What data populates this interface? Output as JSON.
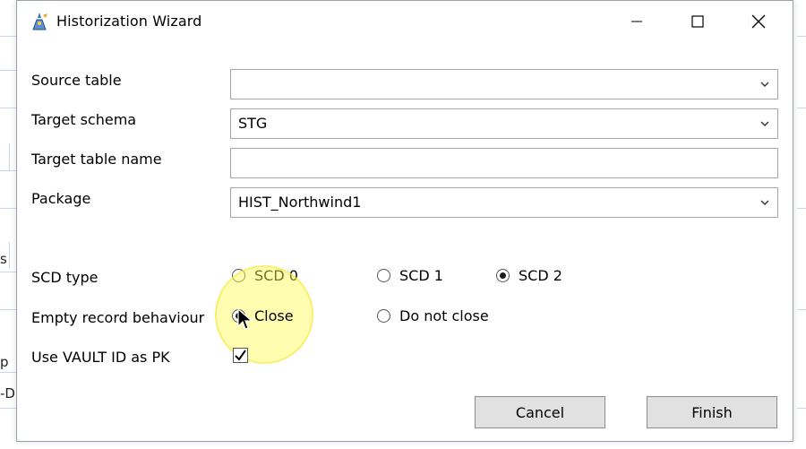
{
  "window": {
    "title": "Historization Wizard"
  },
  "background": {
    "fragment_s": "s",
    "fragment_p": "p",
    "fragment_d": "-D"
  },
  "form": {
    "source_table": {
      "label": "Source table",
      "value": ""
    },
    "target_schema": {
      "label": "Target schema",
      "value": "STG"
    },
    "target_table_name": {
      "label": "Target table name",
      "value": ""
    },
    "package": {
      "label": "Package",
      "value": "HIST_Northwind1"
    },
    "scd_type": {
      "label": "SCD type",
      "options": [
        {
          "label": "SCD 0",
          "selected": false
        },
        {
          "label": "SCD 1",
          "selected": false
        },
        {
          "label": "SCD 2",
          "selected": true
        }
      ]
    },
    "empty_record_behaviour": {
      "label": "Empty record behaviour",
      "options": [
        {
          "label": "Close",
          "selected": true
        },
        {
          "label": "Do not close",
          "selected": false
        }
      ]
    },
    "use_vault_id": {
      "label": "Use VAULT ID as PK",
      "checked": true
    }
  },
  "buttons": {
    "cancel": "Cancel",
    "finish": "Finish"
  },
  "icons": {
    "app": "wizard-app-icon",
    "minimize": "minimize-icon",
    "maximize": "maximize-icon",
    "close": "close-icon",
    "dropdown": "chevron-down-icon",
    "check": "checkmark-icon",
    "cursor": "mouse-pointer-icon"
  }
}
